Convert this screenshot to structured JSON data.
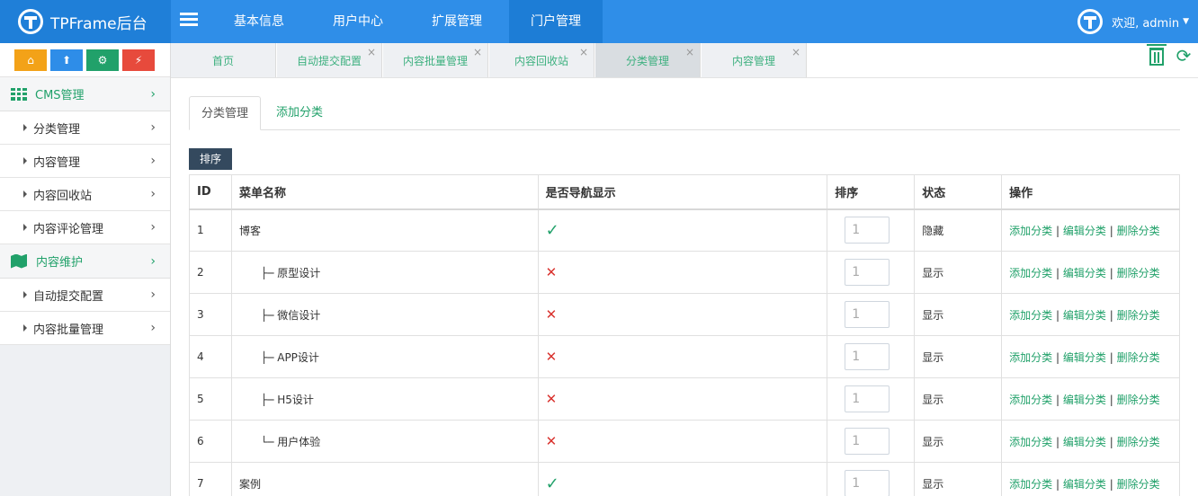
{
  "brand": {
    "title": "TPFrame后台"
  },
  "topnav": [
    {
      "label": "基本信息",
      "active": false
    },
    {
      "label": "用户中心",
      "active": false
    },
    {
      "label": "扩展管理",
      "active": false
    },
    {
      "label": "门户管理",
      "active": true
    }
  ],
  "user": {
    "greeting": "欢迎, admin"
  },
  "quick_buttons": [
    {
      "icon": "home-icon",
      "color": "#f3a218"
    },
    {
      "icon": "upload-icon",
      "color": "#2e8de8"
    },
    {
      "icon": "gears-icon",
      "color": "#21a16a"
    },
    {
      "icon": "plug-icon",
      "color": "#e74a3c"
    }
  ],
  "sidebar": {
    "groups": [
      {
        "label": "CMS管理",
        "icon": "grid-icon",
        "items": [
          "分类管理",
          "内容管理",
          "内容回收站",
          "内容评论管理"
        ]
      },
      {
        "label": "内容维护",
        "icon": "map-icon",
        "items": [
          "自动提交配置",
          "内容批量管理"
        ]
      }
    ]
  },
  "tabs": [
    {
      "label": "首页",
      "closable": false,
      "active": false
    },
    {
      "label": "自动提交配置",
      "closable": true,
      "active": false
    },
    {
      "label": "内容批量管理",
      "closable": true,
      "active": false
    },
    {
      "label": "内容回收站",
      "closable": true,
      "active": false
    },
    {
      "label": "分类管理",
      "closable": true,
      "active": true
    },
    {
      "label": "内容管理",
      "closable": true,
      "active": false
    }
  ],
  "subtabs": {
    "active": "分类管理",
    "link": "添加分类"
  },
  "sort_button": "排序",
  "table": {
    "headers": [
      "ID",
      "菜单名称",
      "是否导航显示",
      "排序",
      "状态",
      "操作"
    ],
    "rows": [
      {
        "id": "1",
        "name": "博客",
        "prefix": "",
        "nav": true,
        "sort": "1",
        "status": "隐藏"
      },
      {
        "id": "2",
        "name": "原型设计",
        "prefix": "├─ ",
        "nav": false,
        "sort": "1",
        "status": "显示"
      },
      {
        "id": "3",
        "name": "微信设计",
        "prefix": "├─ ",
        "nav": false,
        "sort": "1",
        "status": "显示"
      },
      {
        "id": "4",
        "name": "APP设计",
        "prefix": "├─ ",
        "nav": false,
        "sort": "1",
        "status": "显示"
      },
      {
        "id": "5",
        "name": "H5设计",
        "prefix": "├─ ",
        "nav": false,
        "sort": "1",
        "status": "显示"
      },
      {
        "id": "6",
        "name": "用户体验",
        "prefix": "└─ ",
        "nav": false,
        "sort": "1",
        "status": "显示"
      },
      {
        "id": "7",
        "name": "案例",
        "prefix": "",
        "nav": true,
        "sort": "1",
        "status": "显示"
      }
    ],
    "ops": {
      "add": "添加分类",
      "edit": "编辑分类",
      "delete": "删除分类",
      "sep": "|"
    },
    "nav_yes": "✓",
    "nav_no": "✕"
  },
  "colors": {
    "primary": "#2f8ee8",
    "accent": "#21a16a",
    "danger": "#d9332f",
    "dark": "#34495e"
  }
}
